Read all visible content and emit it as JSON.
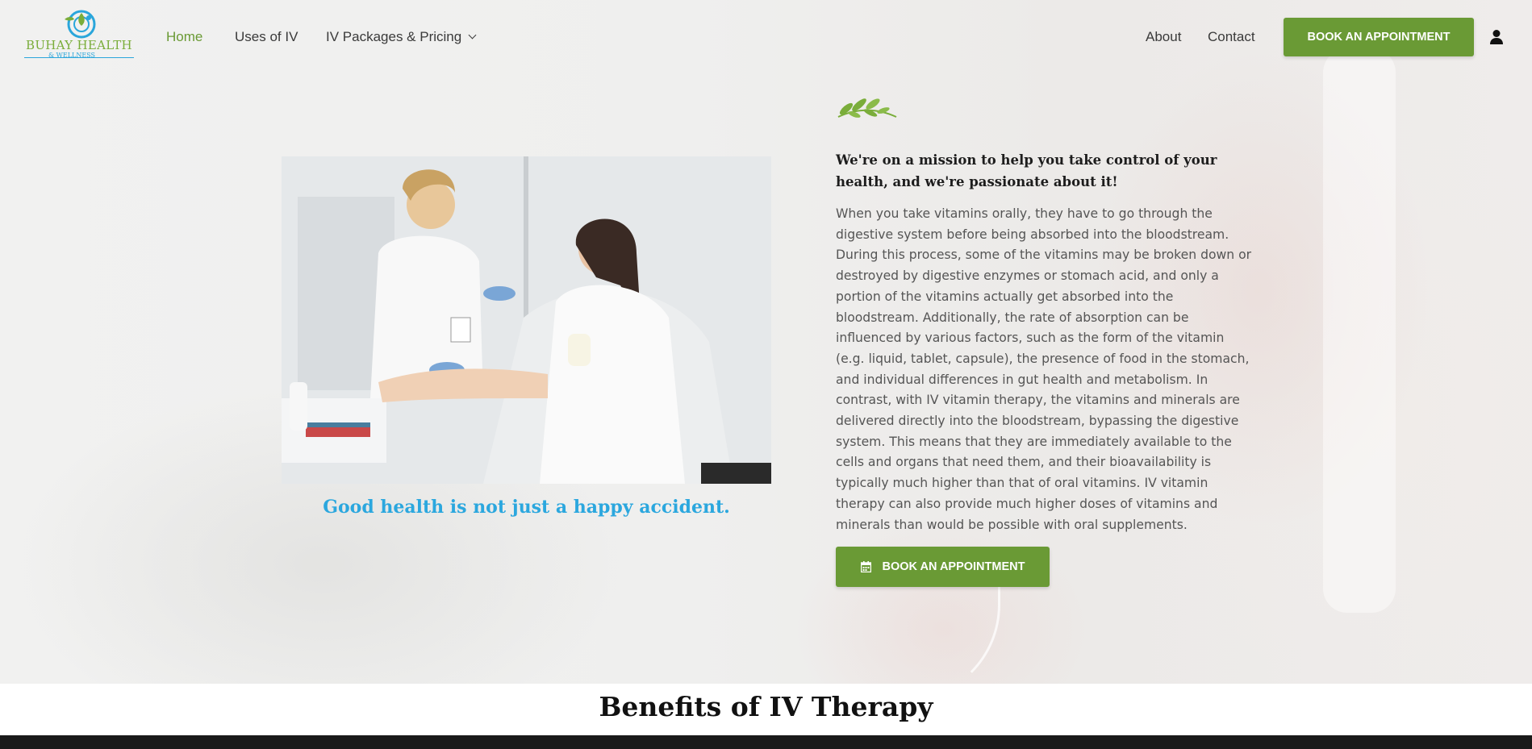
{
  "header": {
    "logo": {
      "name": "BUHAY HEALTH",
      "sub": "& WELLNESS",
      "icon": "leaf-swirl-logo-icon"
    },
    "nav": [
      {
        "label": "Home",
        "active": true
      },
      {
        "label": "Uses of IV"
      },
      {
        "label": "IV Packages & Pricing",
        "dropdown": true
      },
      {
        "label": "About"
      },
      {
        "label": "Contact"
      }
    ],
    "cta_label": "BOOK AN APPOINTMENT",
    "user_icon": "user-icon"
  },
  "main": {
    "image_alt": "Nurse administering IV therapy to smiling woman in white robe",
    "tagline": "Good health is not just a happy accident.",
    "mission": "We're on a mission to help you take control of your health, and we're passionate about it!",
    "body": "When you take vitamins orally, they have to go through the digestive system before being absorbed into the bloodstream. During this process, some of the vitamins may be broken down or destroyed by digestive enzymes or stomach acid, and only a portion of the vitamins actually get absorbed into the bloodstream. Additionally, the rate of absorption can be influenced by various factors, such as the form of the vitamin (e.g. liquid, tablet, capsule), the presence of food in the stomach, and individual differences in gut health and metabolism. In contrast, with IV vitamin therapy, the vitamins and minerals are delivered directly into the bloodstream, bypassing the digestive system. This means that they are immediately available to the cells and organs that need them, and their bioavailability is typically much higher than that of oral vitamins. IV vitamin therapy can also provide much higher doses of vitamins and minerals than would be possible with oral supplements.",
    "cta_label": "BOOK AN APPOINTMENT",
    "cta_icon": "calendar-icon"
  },
  "benefits": {
    "title": "Benefits of IV Therapy"
  },
  "colors": {
    "brand_green": "#6a9a35",
    "brand_blue": "#2ba7de",
    "text_dark": "#1d1d1d",
    "text_body": "#555555"
  }
}
